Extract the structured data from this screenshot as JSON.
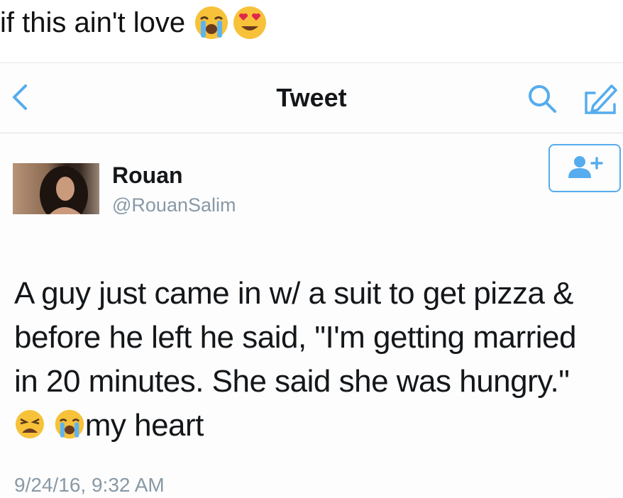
{
  "caption": {
    "text": "if this ain't love",
    "emojis": [
      "loudly-crying-face-emoji",
      "heart-eyes-emoji"
    ]
  },
  "nav": {
    "title": "Tweet",
    "back_icon": "chevron-left-icon",
    "search_icon": "search-icon",
    "compose_icon": "compose-icon"
  },
  "user": {
    "display_name": "Rouan",
    "handle": "@RouanSalim",
    "follow_icon": "add-user-icon"
  },
  "tweet": {
    "lines": [
      "A guy just came in w/ a suit to get pizza &",
      "before he left he said, \"I'm getting married",
      "in 20 minutes. She said she was hungry.\""
    ],
    "last_line_emojis": [
      "weary-face-emoji",
      "loudly-crying-face-emoji"
    ],
    "last_line_text": "my heart",
    "timestamp": "9/24/16, 9:32 AM"
  },
  "colors": {
    "accent": "#55acee",
    "secondary_text": "#8899a6",
    "primary_text": "#14171a"
  }
}
